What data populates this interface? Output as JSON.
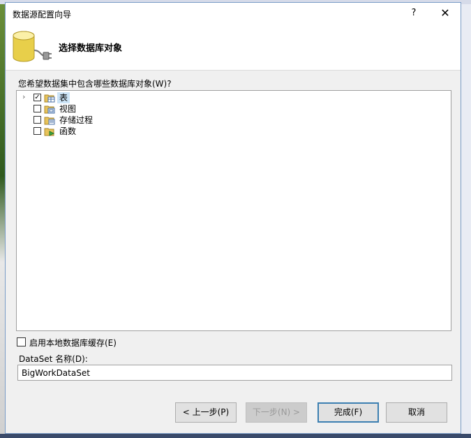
{
  "window": {
    "title": "数据源配置向导",
    "help_glyph": "?",
    "close_glyph": "✕"
  },
  "header": {
    "title": "选择数据库对象"
  },
  "prompt": "您希望数据集中包含哪些数据库对象(W)?",
  "tree": {
    "items": [
      {
        "label": "表",
        "checked": true,
        "expander": "›",
        "selected": true
      },
      {
        "label": "视图",
        "checked": false
      },
      {
        "label": "存储过程",
        "checked": false
      },
      {
        "label": "函数",
        "checked": false
      }
    ]
  },
  "cache_option": {
    "label": "启用本地数据库缓存(E)",
    "checked": false
  },
  "dataset": {
    "label": "DataSet 名称(D):",
    "value": "BigWorkDataSet"
  },
  "buttons": {
    "prev": "< 上一步(P)",
    "next": "下一步(N) >",
    "finish": "完成(F)",
    "cancel": "取消"
  },
  "checkmark_glyph": "✓"
}
